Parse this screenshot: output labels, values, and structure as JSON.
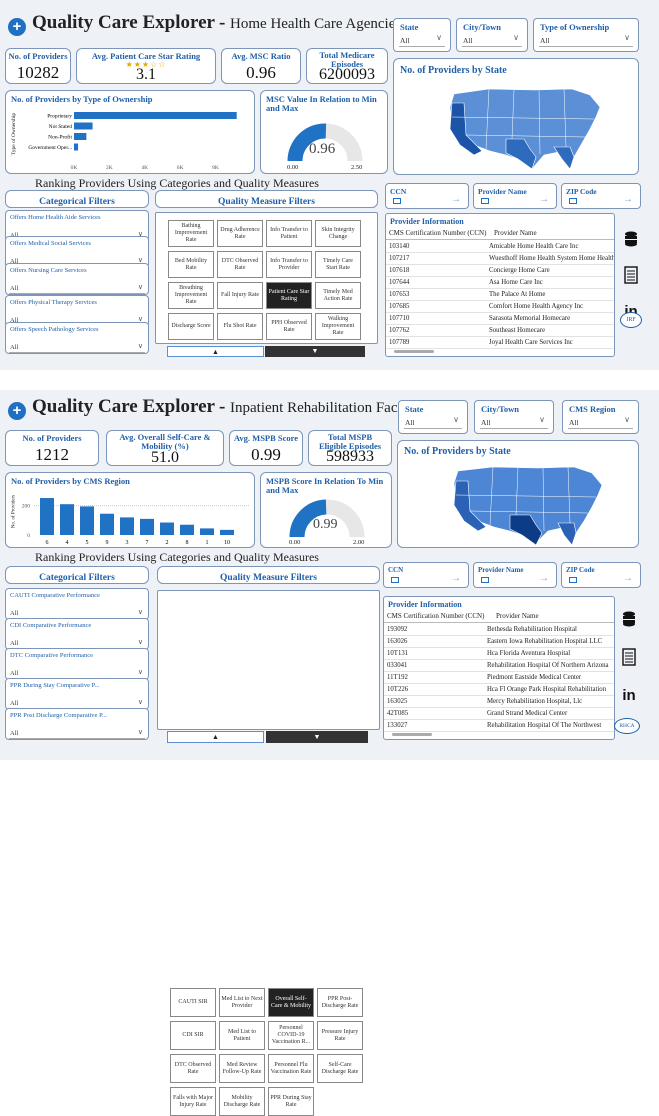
{
  "hh": {
    "title": "Quality Care Explorer",
    "subtitle": "Home Health Care Agencies",
    "filters": [
      {
        "label": "State",
        "value": "All"
      },
      {
        "label": "City/Town",
        "value": "All"
      },
      {
        "label": "Type of Ownership",
        "value": "All"
      }
    ],
    "kpis": [
      {
        "label": "No. of Providers",
        "value": "10282"
      },
      {
        "label": "Avg. Patient Care Star Rating",
        "value": "3.1",
        "stars": "★★★☆☆"
      },
      {
        "label": "Avg. MSC Ratio",
        "value": "0.96"
      },
      {
        "label": "Total Medicare Episodes",
        "value": "6200093"
      }
    ],
    "ownership_title": "No. of Providers by Type of Ownership",
    "ownership_ylabel": "Type of Ownership",
    "gauge_title": "MSC Value In Relation to Min and Max",
    "gauge_value": "0.96",
    "gauge_min": "0.00",
    "gauge_max": "2.50",
    "map_title": "No. of Providers by State",
    "ranking_title": "Ranking Providers Using Categories and Quality Measures",
    "cat_title": "Categorical Filters",
    "cat_filters": [
      {
        "label": "Offers Home Health Aide Services",
        "value": "All"
      },
      {
        "label": "Offers Medical Social Services",
        "value": "All"
      },
      {
        "label": "Offers Nursing Care Services",
        "value": "All"
      },
      {
        "label": "Offers Physical Therapy Services",
        "value": "All"
      },
      {
        "label": "Offers Speech Pathology Services",
        "value": "All"
      }
    ],
    "qm_title": "Quality Measure Filters",
    "measures": [
      "Bathing Improvement Rate",
      "Drug Adherence Rate",
      "Info Transfer to Patient",
      "Skin Integrity Change",
      "Bed Mobility Rate",
      "DTC Observed Rate",
      "Info Transfer to Provider",
      "Timely Care Start Rate",
      "Breathing Improvement Rate",
      "Fall Injury Rate",
      "Patient Care Star Rating",
      "Timely Med Action Rate",
      "Discharge Score",
      "Flu Shot Rate",
      "PPH Observed Rate",
      "Walking Improvement Rate"
    ],
    "search": [
      {
        "label": "CCN"
      },
      {
        "label": "Provider Name"
      },
      {
        "label": "ZIP Code"
      }
    ],
    "info_title": "Provider Information",
    "col1": "CMS Certification Number (CCN)",
    "col2": "Provider Name",
    "rows": [
      [
        "103140",
        "Amicable Home Health Care Inc"
      ],
      [
        "107217",
        "Wuesthoff Home Health System Home Health"
      ],
      [
        "107618",
        "Concierge Home Care"
      ],
      [
        "107644",
        "Asa Home Care Inc"
      ],
      [
        "107653",
        "The Palace At Home"
      ],
      [
        "107685",
        "Comfort Home Health Agency Inc"
      ],
      [
        "107710",
        "Sarasota Memorial Homecare"
      ],
      [
        "107762",
        "Southeast Homecare"
      ],
      [
        "107789",
        "Joyal Health Care Services Inc"
      ]
    ],
    "badge": "IRF",
    "nav_up": "▲",
    "nav_down": "▼"
  },
  "irf": {
    "title": "Quality Care Explorer",
    "subtitle": "Inpatient Rehabilitation Facilities",
    "filters": [
      {
        "label": "State",
        "value": "All"
      },
      {
        "label": "City/Town",
        "value": "All"
      },
      {
        "label": "CMS Region",
        "value": "All"
      }
    ],
    "kpis": [
      {
        "label": "No. of Providers",
        "value": "1212"
      },
      {
        "label": "Avg. Overall Self-Care & Mobility (%)",
        "value": "51.0"
      },
      {
        "label": "Avg. MSPB Score",
        "value": "0.99"
      },
      {
        "label": "Total MSPB Eligible Episodes",
        "value": "598933"
      }
    ],
    "region_title": "No. of Providers by CMS Region",
    "region_ylabel": "No. of Providers",
    "gauge_title": "MSPB Score In Relation To Min and Max",
    "gauge_value": "0.99",
    "gauge_min": "0.00",
    "gauge_max": "2.00",
    "map_title": "No. of Providers by State",
    "ranking_title": "Ranking Providers Using Categories and Quality Measures",
    "cat_title": "Categorical Filters",
    "cat_filters": [
      {
        "label": "CAUTI Comparative Performance",
        "value": "All"
      },
      {
        "label": "CDI Comparative Performance",
        "value": "All"
      },
      {
        "label": "DTC Comparative Performance",
        "value": "All"
      },
      {
        "label": "PPR During Stay Comparative P...",
        "value": "All"
      },
      {
        "label": "PPR Post Discharge Comparative P...",
        "value": "All"
      }
    ],
    "qm_title": "Quality Measure Filters",
    "measures": [
      "CAUTI SIR",
      "Med List to Next Provider",
      "Overall Self-Care & Mobility",
      "PPR Post-Discharge Rate",
      "CDI SIR",
      "Med List to Patient",
      "Personnel COVID-19 Vaccination R...",
      "Pressure Injury Rate",
      "DTC Observed Rate",
      "Med Review Follow-Up Rate",
      "Personnel Flu Vaccination Rate",
      "Self-Care Discharge Rate",
      "Falls with Major Injury Rate",
      "Mobility Discharge Rate",
      "PPR During Stay Rate",
      ""
    ],
    "search": [
      {
        "label": "CCN"
      },
      {
        "label": "Provider Name"
      },
      {
        "label": "ZIP Code"
      }
    ],
    "info_title": "Provider Information",
    "col1": "CMS Certification Number (CCN)",
    "col2": "Provider Name",
    "rows": [
      [
        "193092",
        "Bethesda Rehabilitation Hospital"
      ],
      [
        "163026",
        "Eastern Iowa Rehabilitation Hospital LLC"
      ],
      [
        "10T131",
        "Hca Florida Aventura Hospital"
      ],
      [
        "033041",
        "Rehabilitation Hospital Of Northern Arizona"
      ],
      [
        "11T192",
        "Piedmont Eastside Medical Center"
      ],
      [
        "10T226",
        "Hca Fl Orange Park Hospital Rehabilitation"
      ],
      [
        "163025",
        "Mercy Rehabilitation Hospital, Llc"
      ],
      [
        "42T085",
        "Grand Strand Medical Center"
      ],
      [
        "133027",
        "Rehabilitation Hospital Of The Northwest"
      ]
    ],
    "badge": "RHCA",
    "nav_up": "▲",
    "nav_down": "▼"
  },
  "chart_data": [
    {
      "type": "bar",
      "orientation": "horizontal",
      "title": "No. of Providers by Type of Ownership",
      "ylabel": "Type of Ownership",
      "categories": [
        "Proprietary",
        "Not Stated",
        "Non-Profit",
        "Government Oper..."
      ],
      "values": [
        9200,
        1050,
        700,
        230
      ],
      "x_ticks": [
        "0K",
        "2K",
        "4K",
        "6K",
        "8K"
      ],
      "xlim": [
        0,
        9500
      ]
    },
    {
      "type": "bar",
      "title": "No. of Providers by CMS Region",
      "ylabel": "No. of Providers",
      "categories": [
        "6",
        "4",
        "5",
        "9",
        "3",
        "7",
        "2",
        "8",
        "1",
        "10"
      ],
      "values": [
        252,
        210,
        195,
        145,
        120,
        110,
        85,
        70,
        45,
        35
      ],
      "y_ticks": [
        "0",
        "200"
      ],
      "ylim": [
        0,
        300
      ]
    }
  ]
}
